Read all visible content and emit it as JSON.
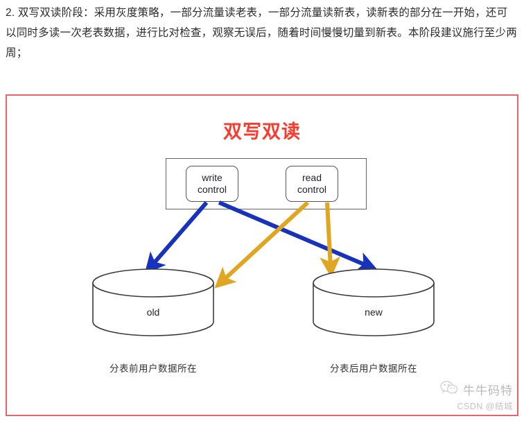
{
  "intro": {
    "paragraph": "2. 双写双读阶段：采用灰度策略，一部分流量读老表，一部分流量读新表，读新表的部分在一开始，还可以同时多读一次老表数据，进行比对检查，观察无误后，随着时间慢慢切量到新表。本阶段建议施行至少两周；"
  },
  "figure": {
    "title": "双写双读",
    "title_color": "#fb3a2e",
    "frame_color": "#e8646a",
    "nodes": {
      "write_control": {
        "line1": "write",
        "line2": "control"
      },
      "read_control": {
        "line1": "read",
        "line2": "control"
      }
    },
    "stores": [
      {
        "id": "old",
        "label": "old",
        "caption": "分表前用户数据所在"
      },
      {
        "id": "new",
        "label": "new",
        "caption": "分表后用户数据所在"
      }
    ],
    "arrows": {
      "write_color": "#1733bb",
      "read_color": "#e0a521",
      "write_to_old": "write control → old",
      "write_to_new": "write control → new",
      "read_to_old": "read control → old",
      "read_to_new": "read control → new"
    }
  },
  "watermark": {
    "brand": "牛牛码特",
    "credit": "CSDN @结城",
    "icon": "wechat-icon"
  }
}
